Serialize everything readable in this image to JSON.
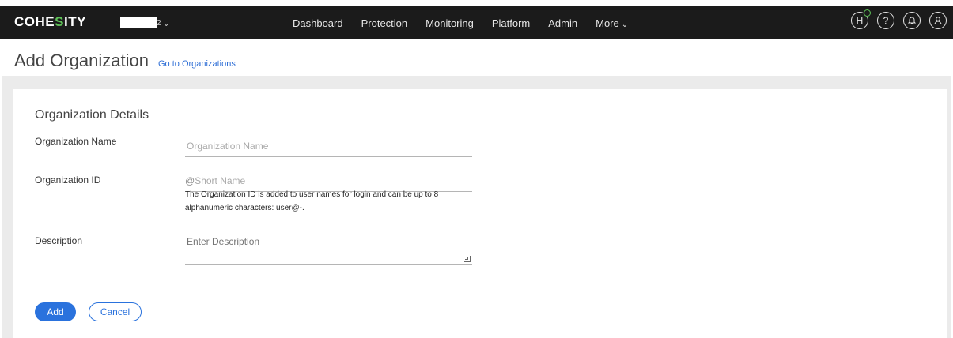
{
  "app": {
    "logo_prefix": "COHE",
    "logo_accent": "S",
    "logo_suffix": "ITY",
    "cluster_suffix": "2"
  },
  "nav": {
    "items": [
      "Dashboard",
      "Protection",
      "Monitoring",
      "Platform",
      "Admin"
    ],
    "more_label": "More"
  },
  "header_icons": {
    "health_label": "H",
    "help_label": "?"
  },
  "page": {
    "title": "Add Organization",
    "goto_link": "Go to Organizations"
  },
  "form": {
    "section_title": "Organization Details",
    "name_label": "Organization Name",
    "name_placeholder": "Organization Name",
    "name_value": "",
    "id_label": "Organization ID",
    "id_prefix": "@",
    "id_placeholder": "Short Name",
    "id_value": "",
    "id_hint": "The Organization ID is added to user names for login and can be up to 8 alphanumeric characters: user@-.",
    "description_label": "Description",
    "description_placeholder": "Enter Description",
    "description_value": ""
  },
  "actions": {
    "add_label": "Add",
    "cancel_label": "Cancel"
  },
  "colors": {
    "topbar": "#1b1b1b",
    "accent_green": "#5ec157",
    "primary_blue": "#2a72dd",
    "link_blue": "#2f6fd6",
    "band_grey": "#ebebeb"
  }
}
